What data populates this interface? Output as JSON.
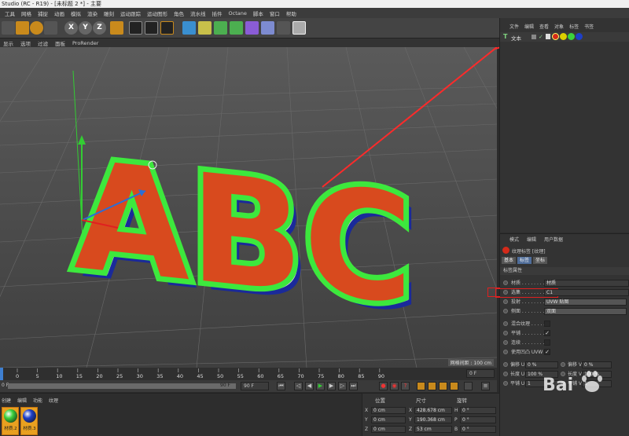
{
  "window": {
    "title": "Studio (RC - R19) - [未标题 2 *] - 主要"
  },
  "menu": [
    "工具",
    "网格",
    "捕捉",
    "动画",
    "模拟",
    "渲染",
    "雕刻",
    "运动跟踪",
    "运动图形",
    "角色",
    "流水线",
    "插件",
    "Octane",
    "脚本",
    "窗口",
    "帮助"
  ],
  "toolbar": {
    "axis_x": "X",
    "axis_y": "Y",
    "axis_z": "Z"
  },
  "viewport_menu": [
    "显示",
    "选项",
    "过滤",
    "面板",
    "ProRender"
  ],
  "viewport": {
    "scene_text": "ABC",
    "grid_info": "网格间距 : 100 cm"
  },
  "object_manager": {
    "menu": [
      "文件",
      "编辑",
      "查看",
      "对象",
      "标签",
      "书签"
    ],
    "object_name": "文本"
  },
  "attributes": {
    "menu": [
      "模式",
      "编辑",
      "用户数据"
    ],
    "tag_title": "纹理标签 [纹理]",
    "tabs": [
      "基本",
      "标签",
      "坐标"
    ],
    "section": "标签属性",
    "rows": [
      {
        "label": "材质 . . . . . . . . .",
        "value": "材质"
      },
      {
        "label": "选集 . . . . . . . . .",
        "value": "C1"
      },
      {
        "label": "投射 . . . . . . . . .",
        "value": "UVW 贴图"
      },
      {
        "label": "侧面 . . . . . . . . .",
        "value": "双面"
      }
    ],
    "checks": [
      {
        "label": "混合纹理 . . . . . .",
        "checked": false
      },
      {
        "label": "平铺 . . . . . . . . .",
        "checked": true
      },
      {
        "label": "连续 . . . . . . . . .",
        "checked": false
      },
      {
        "label": "使用凹凸 UVW",
        "checked": true
      }
    ],
    "offset": [
      {
        "label": "偏移 U",
        "value": "0 %",
        "label2": "偏移 V",
        "value2": "0 %"
      },
      {
        "label": "长度 U",
        "value": "100 %",
        "label2": "长度 V",
        "value2": "100 %"
      },
      {
        "label": "平铺 U",
        "value": "1",
        "label2": "平铺 V",
        "value2": "1"
      }
    ]
  },
  "timeline": {
    "ticks": [
      "0",
      "5",
      "10",
      "15",
      "20",
      "25",
      "30",
      "35",
      "40",
      "45",
      "50",
      "55",
      "60",
      "65",
      "70",
      "75",
      "80",
      "85",
      "90"
    ],
    "current_frame": "0 F",
    "start": "0 F",
    "end_field": "90 F",
    "end_field2": "90 F"
  },
  "materials": {
    "menu": [
      "创建",
      "编辑",
      "功能",
      "纹理"
    ],
    "items": [
      {
        "name": "材质.2",
        "color": "#3cd23c"
      },
      {
        "name": "材质.3",
        "color": "#1e3fc8"
      }
    ]
  },
  "coordinates": {
    "headers": [
      "位置",
      "尺寸",
      "旋转"
    ],
    "rows": [
      {
        "a": "X",
        "pos": "0 cm",
        "b": "X",
        "size": "428.678 cm",
        "c": "H",
        "rot": "0 °"
      },
      {
        "a": "Y",
        "pos": "0 cm",
        "b": "Y",
        "size": "190.368 cm",
        "c": "P",
        "rot": "0 °"
      },
      {
        "a": "Z",
        "pos": "0 cm",
        "b": "Z",
        "size": "53 cm",
        "c": "B",
        "rot": "0 °"
      }
    ]
  },
  "watermark": "Bai"
}
